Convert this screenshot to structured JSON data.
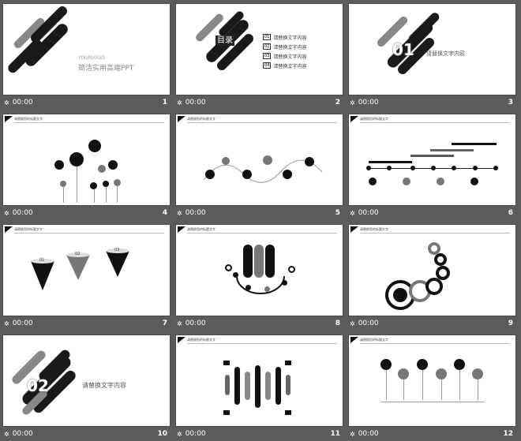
{
  "slides": [
    {
      "number": "1",
      "time": "00:00",
      "logo": "YOURLOGO",
      "title": "简洁实用高端PPT"
    },
    {
      "number": "2",
      "time": "00:00",
      "toc_title": "目录",
      "items": [
        {
          "num": "01",
          "label": "请替换文字内容"
        },
        {
          "num": "02",
          "label": "请替换文字内容"
        },
        {
          "num": "03",
          "label": "请替换文字内容"
        },
        {
          "num": "04",
          "label": "请替换文字内容"
        }
      ]
    },
    {
      "number": "3",
      "time": "00:00",
      "title": "请替换文字内容",
      "big": "01"
    },
    {
      "number": "4",
      "time": "00:00",
      "header": "请替换您的标题文字"
    },
    {
      "number": "5",
      "time": "00:00",
      "header": "请替换您的标题文字"
    },
    {
      "number": "6",
      "time": "00:00",
      "header": "请替换您的标题文字"
    },
    {
      "number": "7",
      "time": "00:00",
      "header": "请替换您的标题文字",
      "cones": [
        "01",
        "02",
        "03"
      ]
    },
    {
      "number": "8",
      "time": "00:00",
      "header": "请替换您的标题文字"
    },
    {
      "number": "9",
      "time": "00:00",
      "header": "请替换您的标题文字"
    },
    {
      "number": "10",
      "time": "00:00",
      "title": "请替换文字内容",
      "big": "02"
    },
    {
      "number": "11",
      "time": "00:00",
      "header": "请替换您的标题文字"
    },
    {
      "number": "12",
      "time": "00:00",
      "header": "请替换您的标题文字"
    }
  ]
}
